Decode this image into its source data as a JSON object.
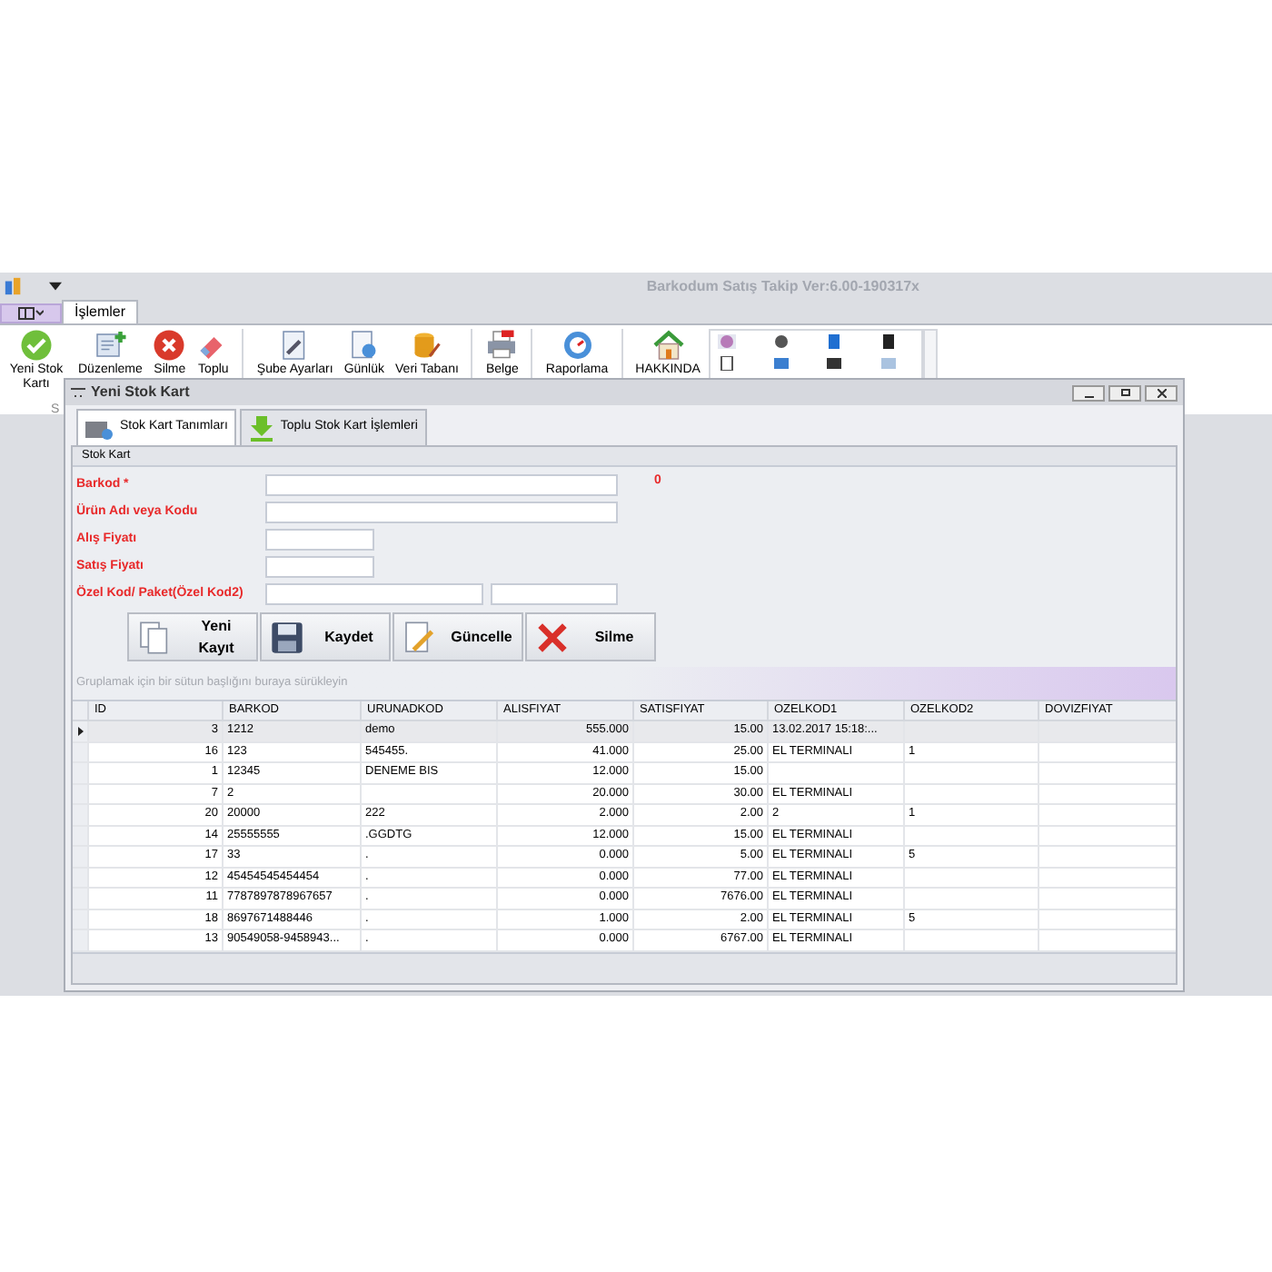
{
  "app": {
    "title": "Barkodum Satış Takip Ver:6.00-190317x",
    "ribbon_tabs": [
      {
        "label": "İşlemler",
        "selected": true
      }
    ],
    "ribbon_buttons": [
      {
        "label": "Yeni Stok Kartı"
      },
      {
        "label": "Düzenleme"
      },
      {
        "label": "Silme"
      },
      {
        "label": "Toplu"
      },
      {
        "label": "Şube Ayarları"
      },
      {
        "label": "Günlük"
      },
      {
        "label": "Veri Tabanı"
      },
      {
        "label": "Belge"
      },
      {
        "label": "Raporlama"
      },
      {
        "label": "HAKKINDA"
      }
    ],
    "group_label": "S"
  },
  "window": {
    "title": "Yeni Stok Kart",
    "tabs": [
      {
        "label": "Stok Kart Tanımları",
        "selected": true
      },
      {
        "label": "Toplu Stok Kart İşlemleri",
        "selected": false
      }
    ],
    "group_title": "Stok Kart",
    "fields": [
      {
        "label": "Barkod *",
        "kind": "wide"
      },
      {
        "label": "Ürün Adı veya Kodu",
        "kind": "wide"
      },
      {
        "label": "Alış Fiyatı",
        "kind": "short"
      },
      {
        "label": "Satış Fiyatı",
        "kind": "short"
      },
      {
        "label": "Özel Kod/ Paket(Özel Kod2)",
        "kind": "split"
      }
    ],
    "counter": "0",
    "buttons": [
      {
        "label": "Yeni Kayıt"
      },
      {
        "label": "Kaydet"
      },
      {
        "label": "Güncelle"
      },
      {
        "label": "Silme"
      }
    ],
    "group_panel": "Gruplamak için bir sütun başlığını buraya sürükleyin",
    "table": {
      "columns": [
        "ID",
        "BARKOD",
        "URUNADKOD",
        "ALISFIYAT",
        "SATISFIYAT",
        "OZELKOD1",
        "OZELKOD2",
        "DOVIZFIYAT"
      ],
      "rows": [
        {
          "selected": true,
          "cells": [
            "3",
            "1212",
            "demo",
            "555.000",
            "15.00",
            "13.02.2017 15:18:...",
            "",
            ""
          ]
        },
        {
          "selected": false,
          "cells": [
            "16",
            "123",
            "545455.",
            "41.000",
            "25.00",
            "EL TERMINALI",
            "1",
            ""
          ]
        },
        {
          "selected": false,
          "cells": [
            "1",
            "12345",
            "DENEME BIS",
            "12.000",
            "15.00",
            "",
            "",
            ""
          ]
        },
        {
          "selected": false,
          "cells": [
            "7",
            "2",
            "",
            "20.000",
            "30.00",
            "EL TERMINALI",
            "",
            ""
          ]
        },
        {
          "selected": false,
          "cells": [
            "20",
            "20000",
            "222",
            "2.000",
            "2.00",
            "2",
            "1",
            ""
          ]
        },
        {
          "selected": false,
          "cells": [
            "14",
            "25555555",
            ".GGDTG",
            "12.000",
            "15.00",
            "EL TERMINALI",
            "",
            ""
          ]
        },
        {
          "selected": false,
          "cells": [
            "17",
            "33",
            ".",
            "0.000",
            "5.00",
            "EL TERMINALI",
            "5",
            ""
          ]
        },
        {
          "selected": false,
          "cells": [
            "12",
            "45454545454454",
            ".",
            "0.000",
            "77.00",
            "EL TERMINALI",
            "",
            ""
          ]
        },
        {
          "selected": false,
          "cells": [
            "11",
            "7787897878967657",
            ".",
            "0.000",
            "7676.00",
            "EL TERMINALI",
            "",
            ""
          ]
        },
        {
          "selected": false,
          "cells": [
            "18",
            "8697671488446",
            ".",
            "1.000",
            "2.00",
            "EL TERMINALI",
            "5",
            ""
          ]
        },
        {
          "selected": false,
          "cells": [
            "13",
            "90549058-9458943...",
            ".",
            "0.000",
            "6767.00",
            "EL TERMINALI",
            "",
            ""
          ]
        }
      ]
    }
  }
}
